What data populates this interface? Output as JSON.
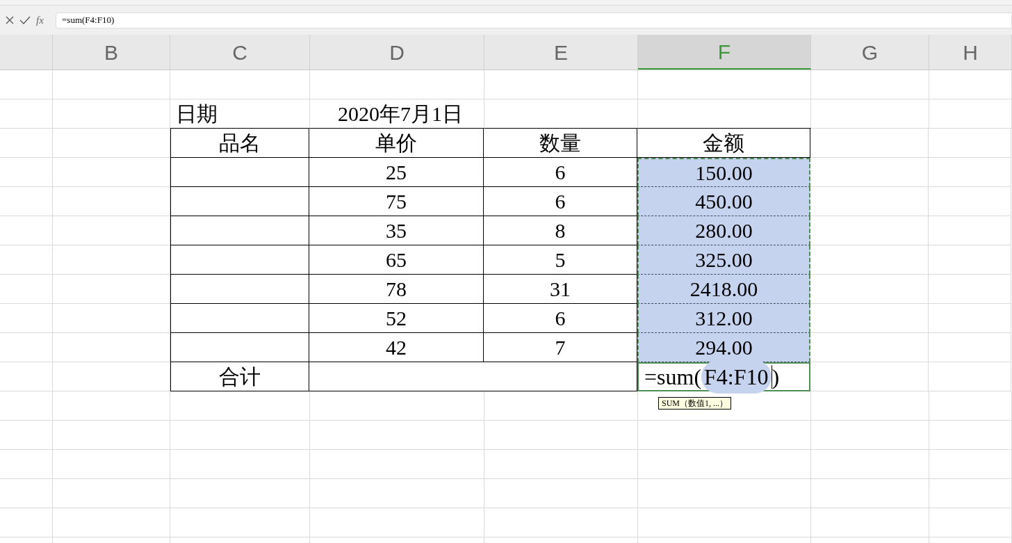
{
  "formula_bar": {
    "fx": "fx",
    "formula": "=sum(F4:F10)"
  },
  "columns": [
    {
      "label": "B",
      "selected": false
    },
    {
      "label": "C",
      "selected": false
    },
    {
      "label": "D",
      "selected": false
    },
    {
      "label": "E",
      "selected": false
    },
    {
      "label": "F",
      "selected": true
    },
    {
      "label": "G",
      "selected": false
    },
    {
      "label": "H",
      "selected": false
    }
  ],
  "table": {
    "date_label": "日期",
    "date_value": "2020年7月1日",
    "headers": [
      "品名",
      "单价",
      "数量",
      "金额"
    ],
    "rows": [
      {
        "price": "25",
        "qty": "6",
        "amount": "150.00",
        "selected": true
      },
      {
        "price": "75",
        "qty": "6",
        "amount": "450.00",
        "selected": true
      },
      {
        "price": "35",
        "qty": "8",
        "amount": "280.00",
        "selected": true
      },
      {
        "price": "65",
        "qty": "5",
        "amount": "325.00",
        "selected": true
      },
      {
        "price": "78",
        "qty": "31",
        "amount": "2418.00",
        "selected": true
      },
      {
        "price": "52",
        "qty": "6",
        "amount": "312.00",
        "selected": true
      },
      {
        "price": "42",
        "qty": "7",
        "amount": "294.00",
        "selected": true
      }
    ],
    "total_label": "合计",
    "editing": {
      "prefix": "=sum(",
      "range": "F4:F10",
      "suffix": ")"
    },
    "tooltip": "SUM（数值1, ...）"
  }
}
